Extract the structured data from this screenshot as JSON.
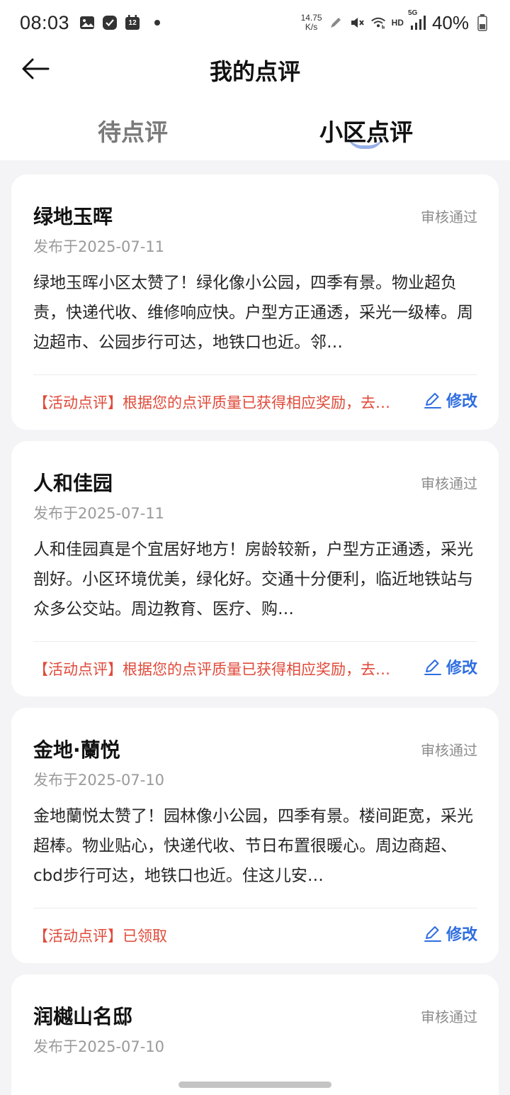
{
  "status_bar": {
    "time": "08:03",
    "notification_badge": "12",
    "net_speed_value": "14.75",
    "net_speed_unit": "K/s",
    "hd_label": "HD",
    "network_label": "5G",
    "battery": "40%",
    "icons": [
      "gallery-icon",
      "check-app-icon",
      "calendar-icon",
      "dot-icon",
      "pen-icon",
      "mute-icon",
      "wifi-icon",
      "signal-icon",
      "battery-icon"
    ]
  },
  "nav": {
    "title": "我的点评",
    "back_icon": "arrow-left-icon"
  },
  "tabs": [
    {
      "label": "待点评",
      "active": false
    },
    {
      "label": "小区点评",
      "active": true
    }
  ],
  "colors": {
    "accent_blue": "#2f6ee0",
    "activity_red": "#e04a3a",
    "status_gray": "#8d8d8d",
    "background": "#f4f4f6"
  },
  "reviews": [
    {
      "name": "绿地玉晖",
      "status": "审核通过",
      "date": "发布于2025-07-11",
      "text": "绿地玉晖小区太赞了！绿化像小公园，四季有景。物业超负责，快递代收、维修响应快。户型方正通透，采光一级棒。周边超市、公园步行可达，地铁口也近。邻…",
      "activity": "【活动点评】根据您的点评质量已获得相应奖励，去…",
      "edit_label": "修改"
    },
    {
      "name": "人和佳园",
      "status": "审核通过",
      "date": "发布于2025-07-11",
      "text": "人和佳园真是个宜居好地方！房龄较新，户型方正通透，采光剖好。小区环境优美，绿化好。交通十分便利，临近地铁站与众多公交站。周边教育、医疗、购…",
      "activity": "【活动点评】根据您的点评质量已获得相应奖励，去…",
      "edit_label": "修改"
    },
    {
      "name": "金地·蘭悦",
      "status": "审核通过",
      "date": "发布于2025-07-10",
      "text": "金地蘭悦太赞了！园林像小公园，四季有景。楼间距宽，采光超棒。物业贴心，快递代收、节日布置很暖心。周边商超、cbd步行可达，地铁口也近。住这儿安…",
      "activity": "【活动点评】已领取",
      "edit_label": "修改"
    },
    {
      "name": "润樾山名邸",
      "status": "审核通过",
      "date": "发布于2025-07-10",
      "text": "",
      "activity": "",
      "edit_label": ""
    }
  ]
}
